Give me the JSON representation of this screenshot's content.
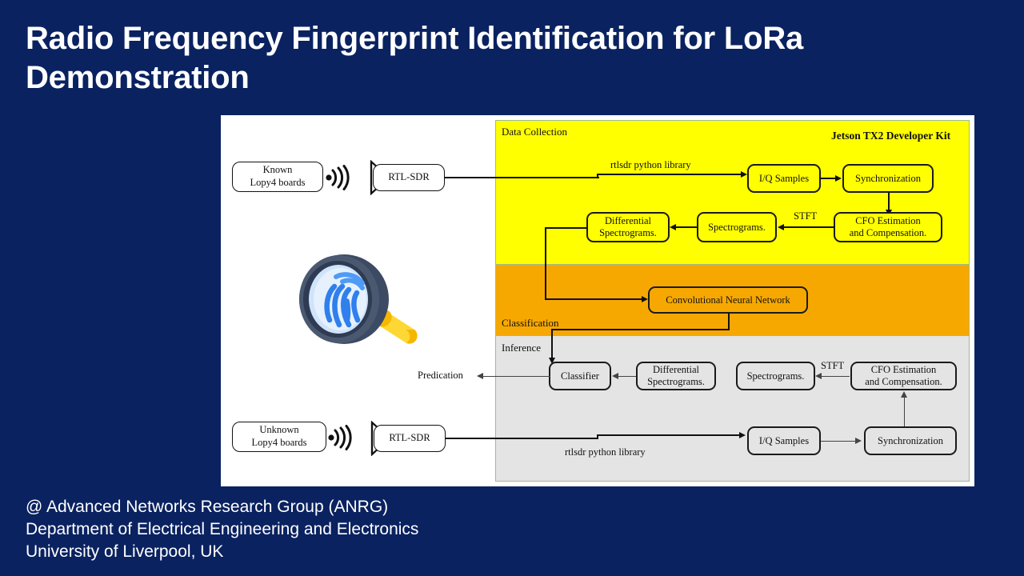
{
  "slide": {
    "title": "Radio Frequency Fingerprint Identification for LoRa Demonstration",
    "background_color": "#0a2260",
    "title_color": "#ffffff"
  },
  "footer": {
    "line1": "@ Advanced Networks Research Group (ANRG)",
    "line2": "Department of Electrical Engineering and Electronics",
    "line3": "University of Liverpool, UK"
  },
  "diagram": {
    "panel_background": "#ffffff",
    "bands": [
      {
        "id": "data-collection",
        "label": "Data Collection",
        "color": "#ffff00"
      },
      {
        "id": "classification",
        "label": "Classification",
        "color": "#f7a800"
      },
      {
        "id": "inference",
        "label": "Inference",
        "color": "#e4e4e4"
      }
    ],
    "hardware_title": "Jetson TX2 Developer Kit",
    "devices": {
      "known_boards": {
        "line1": "Known",
        "line2": "Lopy4 boards"
      },
      "unknown_boards": {
        "line1": "Unknown",
        "line2": "Lopy4 boards"
      },
      "receiver_top": "RTL-SDR",
      "receiver_bottom": "RTL-SDR"
    },
    "collection_boxes": {
      "iq_samples": "I/Q Samples",
      "synchronization": "Synchronization",
      "cfo_line1": "CFO Estimation",
      "cfo_line2": "and Compensation.",
      "spectrograms": "Spectrograms.",
      "diff_line1": "Differential",
      "diff_line2": "Spectrograms."
    },
    "classification_boxes": {
      "cnn": "Convolutional  Neural Network"
    },
    "inference_boxes": {
      "iq_samples": "I/Q Samples",
      "synchronization": "Synchronization",
      "cfo_line1": "CFO Estimation",
      "cfo_line2": "and Compensation.",
      "spectrograms": "Spectrograms.",
      "diff_line1": "Differential",
      "diff_line2": "Spectrograms.",
      "classifier": "Classifier"
    },
    "edge_labels": {
      "rtlsdr_top": "rtlsdr  python  library",
      "rtlsdr_bottom": "rtlsdr  python  library",
      "stft_top": "STFT",
      "stft_bottom": "STFT",
      "prediction": "Predication"
    },
    "icons": {
      "fingerprint_magnifier": "fingerprint-magnifier-icon",
      "radio_waves": "radio-waves-icon",
      "antenna": "antenna-icon"
    }
  }
}
